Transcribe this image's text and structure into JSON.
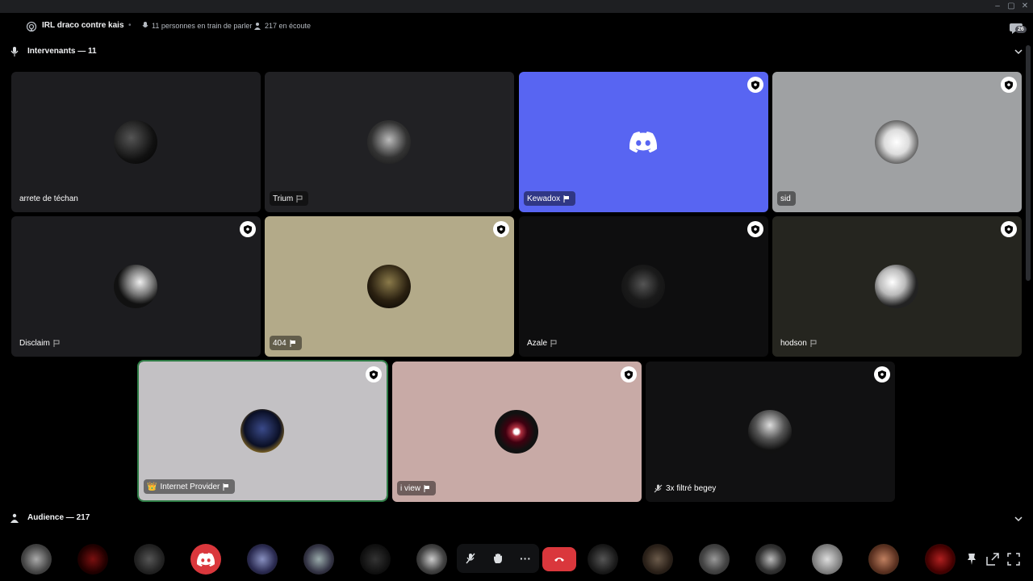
{
  "window": {
    "min_icon": "minimize-icon",
    "max_icon": "maximize-icon",
    "close_icon": "close-icon"
  },
  "header": {
    "title": "IRL draco contre kais",
    "separator": "•",
    "speakers_text": "11 personnes en train de parler",
    "listeners_text": "217 en écoute",
    "chat_badge": "26"
  },
  "speakers_section": {
    "title": "Intervenants — 11"
  },
  "audience_section": {
    "title": "Audience — 217"
  },
  "tiles": [
    {
      "name": "arrete de téchan",
      "bg": "#1d1d20",
      "flag": false,
      "shield": false,
      "tagbg": false
    },
    {
      "name": "Trium",
      "bg": "#212124",
      "flag": true,
      "shield": false,
      "tagbg": true
    },
    {
      "name": "Kewadox",
      "bg": "#5865f2",
      "flag": true,
      "shield": true,
      "tagbg": true,
      "discord": true
    },
    {
      "name": "sid",
      "bg": "#9fa1a3",
      "flag": false,
      "shield": true,
      "tagbg": true
    },
    {
      "name": "Disclaim",
      "bg": "#1c1c1f",
      "flag": true,
      "shield": true,
      "tagbg": false
    },
    {
      "name": "404",
      "bg": "#b3aa89",
      "flag": true,
      "shield": true,
      "tagbg": true
    },
    {
      "name": "Azale",
      "bg": "#0e0e0f",
      "flag": true,
      "shield": true,
      "tagbg": false
    },
    {
      "name": "hodson",
      "bg": "#25251f",
      "flag": true,
      "shield": true,
      "tagbg": false
    },
    {
      "name": "Internet Provider",
      "bg": "#c3c1c4",
      "flag": true,
      "shield": true,
      "tagbg": true,
      "prefix": "👑"
    },
    {
      "name": "i view",
      "bg": "#c8aaa6",
      "flag": true,
      "shield": true,
      "tagbg": true
    },
    {
      "name": "3x filtré begey",
      "bg": "#111112",
      "flag": false,
      "shield": true,
      "tagbg": false,
      "muted": true
    }
  ],
  "controls": {
    "mute_icon": "mic-muted-icon",
    "hand_icon": "raise-hand-icon",
    "more_label": "···",
    "leave_icon": "phone-hangup-icon"
  },
  "colors": {
    "accent": "#5865f2",
    "danger": "#da373c",
    "active_border": "#2f7d46"
  }
}
